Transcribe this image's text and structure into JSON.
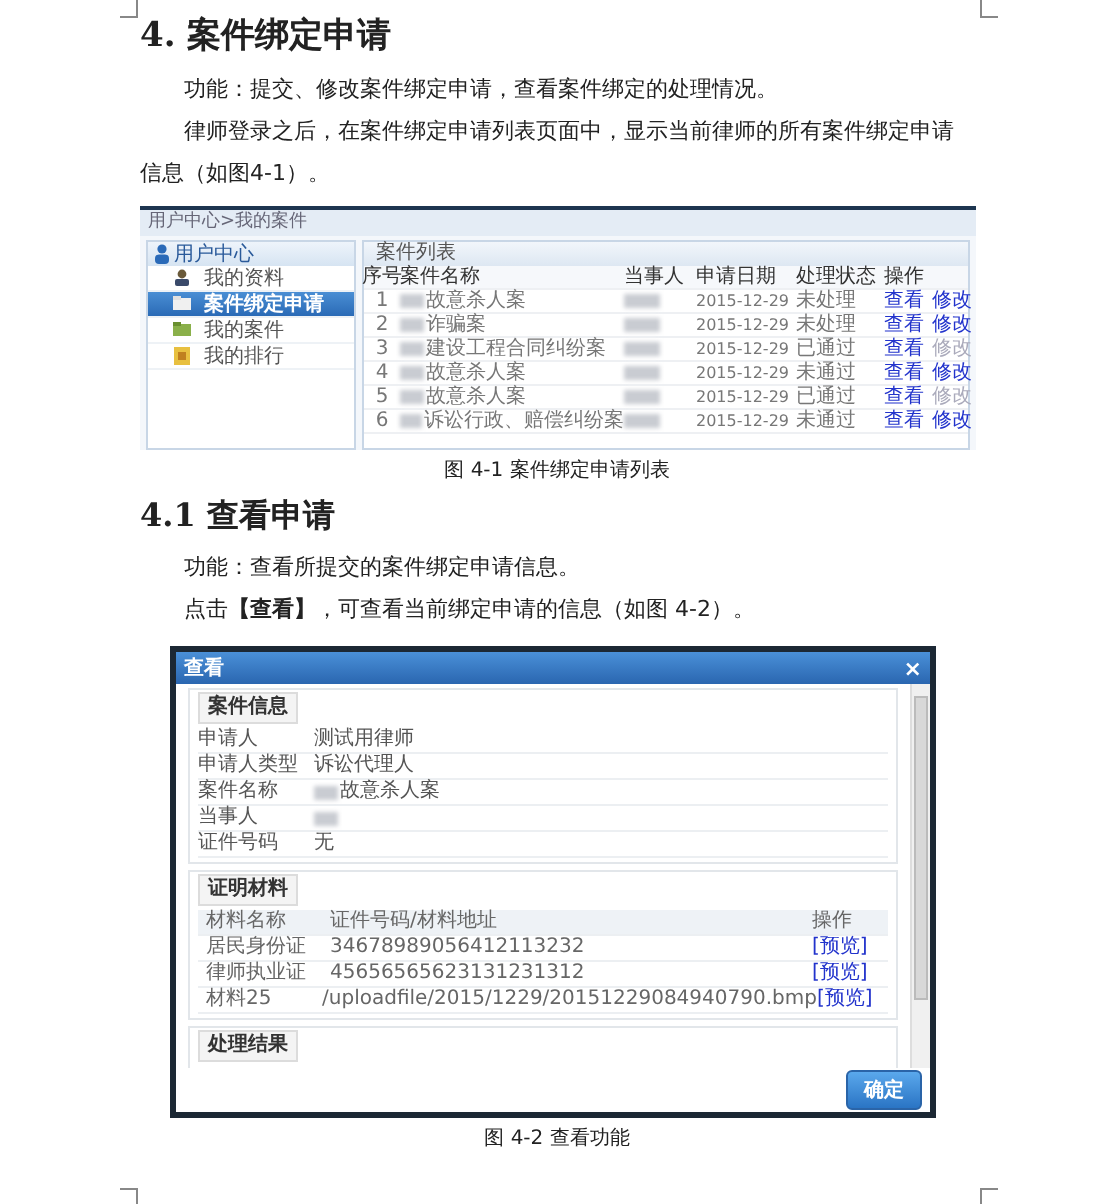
{
  "blocks": [
    {
      "kind": "heading1",
      "text": "4. 案件绑定申请"
    },
    {
      "kind": "paragraph",
      "text": "功能：提交、修改案件绑定申请，查看案件绑定的处理情况。"
    },
    {
      "kind": "paragraph",
      "text": "律师登录之后，在案件绑定申请列表页面中，显示当前律师的所有案件绑定申请信息（如图4-1）。"
    },
    {
      "kind": "list_figure",
      "breadcrumb": "用户中心>我的案件",
      "sidebar_title": "用户中心",
      "sidebar_items": [
        {
          "label": "我的资料",
          "selected": false
        },
        {
          "label": "案件绑定申请",
          "selected": true
        },
        {
          "label": "我的案件",
          "selected": false
        },
        {
          "label": "我的排行",
          "selected": false
        }
      ],
      "panel_title": "案件列表",
      "columns": [
        "序号",
        "案件名称",
        "当事人",
        "申请日期",
        "处理状态",
        "操作"
      ],
      "rows": [
        {
          "no": "1",
          "case": "故意杀人案",
          "case_redacted": true,
          "party_redacted": true,
          "date": "2015-12-29",
          "status": "未处理",
          "actions": [
            {
              "label": "查看",
              "disabled": false
            },
            {
              "label": "修改",
              "disabled": false
            }
          ]
        },
        {
          "no": "2",
          "case": "诈骗案",
          "case_redacted": true,
          "party_redacted": true,
          "date": "2015-12-29",
          "status": "未处理",
          "actions": [
            {
              "label": "查看",
              "disabled": false
            },
            {
              "label": "修改",
              "disabled": false
            }
          ]
        },
        {
          "no": "3",
          "case": "建设工程合同纠纷案",
          "case_redacted": true,
          "party_redacted": true,
          "date": "2015-12-29",
          "status": "已通过",
          "actions": [
            {
              "label": "查看",
              "disabled": false
            },
            {
              "label": "修改",
              "disabled": true
            }
          ]
        },
        {
          "no": "4",
          "case": "故意杀人案",
          "case_redacted": true,
          "party_redacted": true,
          "date": "2015-12-29",
          "status": "未通过",
          "actions": [
            {
              "label": "查看",
              "disabled": false
            },
            {
              "label": "修改",
              "disabled": false
            }
          ]
        },
        {
          "no": "5",
          "case": "故意杀人案",
          "case_redacted": true,
          "party_redacted": true,
          "date": "2015-12-29",
          "status": "已通过",
          "actions": [
            {
              "label": "查看",
              "disabled": false
            },
            {
              "label": "修改",
              "disabled": true
            }
          ]
        },
        {
          "no": "6",
          "case": "诉讼行政、赔偿纠纷案",
          "case_redacted": true,
          "party_redacted": true,
          "date": "2015-12-29",
          "status": "未通过",
          "actions": [
            {
              "label": "查看",
              "disabled": false
            },
            {
              "label": "修改",
              "disabled": false
            }
          ]
        }
      ]
    },
    {
      "kind": "caption",
      "text": "图 4-1  案件绑定申请列表"
    },
    {
      "kind": "heading2",
      "text": "4.1  查看申请"
    },
    {
      "kind": "paragraph",
      "text": "功能：查看所提交的案件绑定申请信息。"
    },
    {
      "kind": "paragraph",
      "text": "点击**【查看】**，可查看当前绑定申请的信息（如图 4-2）。"
    },
    {
      "kind": "dialog_figure",
      "title": "查看",
      "close": "×",
      "sections": [
        {
          "kind": "fields",
          "title": "案件信息",
          "rows": [
            {
              "label": "申请人",
              "value": "测试用律师",
              "redacted": false
            },
            {
              "label": "申请人类型",
              "value": "诉讼代理人",
              "redacted": false
            },
            {
              "label": "案件名称",
              "value": "故意杀人案",
              "redacted": true
            },
            {
              "label": "当事人",
              "redacted": true
            },
            {
              "label": "证件号码",
              "value": "无",
              "redacted": false
            }
          ]
        },
        {
          "kind": "table",
          "title": "证明材料",
          "columns": [
            "材料名称",
            "证件号码/材料地址",
            "操作"
          ],
          "rows": [
            [
              "居民身份证",
              "34678989056412113232",
              "[预览]"
            ],
            [
              "律师执业证",
              "45656565623131231312",
              "[预览]"
            ],
            [
              "材料25",
              "/uploadfile/2015/1229/20151229084940790.bmp",
              "[预览]"
            ]
          ]
        },
        {
          "kind": "empty",
          "title": "处理结果"
        }
      ],
      "ok_button": "确定"
    },
    {
      "kind": "caption",
      "text": "图 4-2  查看功能"
    }
  ]
}
